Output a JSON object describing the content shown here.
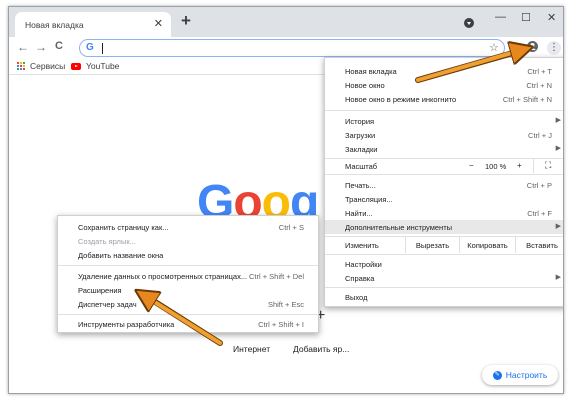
{
  "tab": {
    "title": "Новая вкладка",
    "close": "✕"
  },
  "window_controls": {
    "minimize": "—",
    "maximize": "☐",
    "close": "✕"
  },
  "toolbar": {
    "back": "←",
    "forward": "→",
    "reload": "C",
    "omnibox_logo": "G",
    "star": "☆",
    "extensions": "✦",
    "profile": "👤",
    "menu": "⋮"
  },
  "bookmarks": {
    "apps_label": "Сервисы",
    "youtube_label": "YouTube"
  },
  "page": {
    "logo": "Goog",
    "add_shortcut": "+",
    "shortcut_labels": [
      "Интернет",
      "Добавить яр..."
    ],
    "customize_label": "Настроить"
  },
  "main_menu": {
    "items": [
      {
        "label": "Новая вкладка",
        "shortcut": "Ctrl + T"
      },
      {
        "label": "Новое окно",
        "shortcut": "Ctrl + N"
      },
      {
        "label": "Новое окно в режиме инкогнито",
        "shortcut": "Ctrl + Shift + N"
      },
      {
        "label": "История"
      },
      {
        "label": "Загрузки",
        "shortcut": "Ctrl + J"
      },
      {
        "label": "Закладки"
      },
      {
        "label": "Печать...",
        "shortcut": "Ctrl + P"
      },
      {
        "label": "Трансляция..."
      },
      {
        "label": "Найти...",
        "shortcut": "Ctrl + F"
      },
      {
        "label": "Дополнительные инструменты"
      },
      {
        "label": "Настройки"
      },
      {
        "label": "Справка"
      },
      {
        "label": "Выход"
      }
    ],
    "zoom": {
      "label": "Масштаб",
      "minus": "−",
      "value": "100 %",
      "plus": "+",
      "fullscreen": "⛶"
    },
    "edit": {
      "label": "Изменить",
      "cut": "Вырезать",
      "copy": "Копировать",
      "paste": "Вставить"
    }
  },
  "sub_menu": {
    "items": [
      {
        "label": "Сохранить страницу как...",
        "shortcut": "Ctrl + S"
      },
      {
        "label": "Создать ярлык..."
      },
      {
        "label": "Добавить название окна"
      },
      {
        "label": "Удаление данных о просмотренных страницах...",
        "shortcut": "Ctrl + Shift + Del"
      },
      {
        "label": "Расширения"
      },
      {
        "label": "Диспетчер задач",
        "shortcut": "Shift + Esc"
      },
      {
        "label": "Инструменты разработчика",
        "shortcut": "Ctrl + Shift + I"
      }
    ]
  },
  "colors": {
    "arrow": "#e8871e",
    "google_blue": "#4285f4",
    "google_red": "#ea4335",
    "google_yellow": "#fbbc05",
    "google_green": "#34a853"
  },
  "icons": [
    "close-icon",
    "plus-icon",
    "profile-icon",
    "back-arrow-icon",
    "forward-arrow-icon",
    "reload-icon",
    "star-icon",
    "extensions-icon",
    "kebab-menu-icon",
    "apps-grid-icon",
    "youtube-icon",
    "fullscreen-icon",
    "pencil-icon",
    "chevron-right-icon"
  ]
}
